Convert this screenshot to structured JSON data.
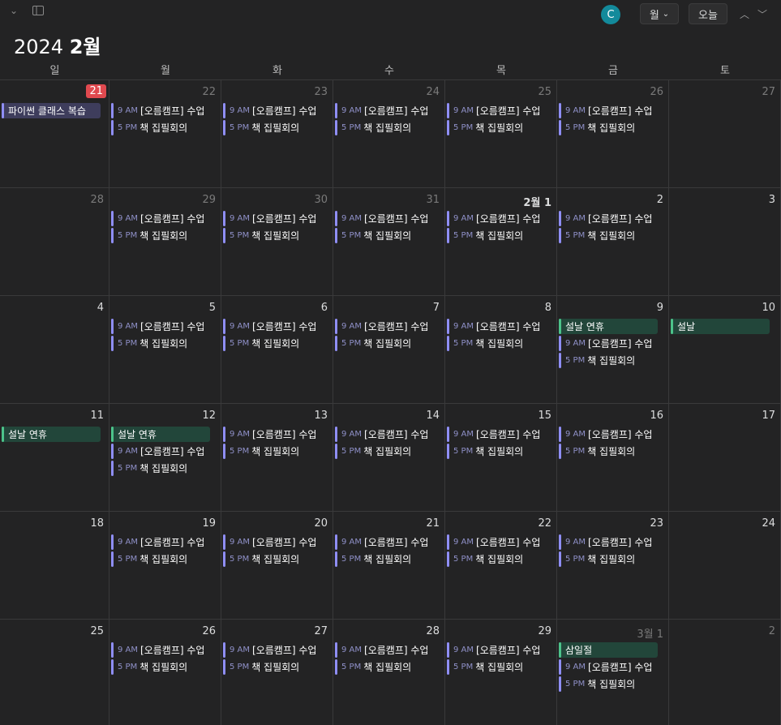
{
  "toolbar": {
    "chevron_glyph": "⌄",
    "sidebar_icon": "sidebar-toggle-icon",
    "avatar_letter": "C",
    "view_label": "월",
    "view_chevron": "⌄",
    "today_label": "오늘",
    "prev_glyph": "︿",
    "next_glyph": "﹀"
  },
  "header": {
    "year": "2024",
    "month": "2월"
  },
  "weekdays": [
    "일",
    "월",
    "화",
    "수",
    "목",
    "금",
    "토"
  ],
  "colors": {
    "background": "#232324",
    "today_badge": "#e0494f",
    "event_bar": "#8f8ef5",
    "holiday": "#4cc38a",
    "avatar": "#138a9b"
  },
  "weeks": [
    [
      {
        "day": "21",
        "dim": false,
        "today": true,
        "events": [
          {
            "type": "allday",
            "style": "study",
            "title": "파이썬 클래스 복습"
          }
        ]
      },
      {
        "day": "22",
        "dim": true,
        "events": [
          {
            "type": "timed",
            "time": "9 AM",
            "title": "[오름캠프] 수업"
          },
          {
            "type": "timed",
            "time": "5 PM",
            "title": "책 집필회의"
          }
        ]
      },
      {
        "day": "23",
        "dim": true,
        "events": [
          {
            "type": "timed",
            "time": "9 AM",
            "title": "[오름캠프] 수업"
          },
          {
            "type": "timed",
            "time": "5 PM",
            "title": "책 집필회의"
          }
        ]
      },
      {
        "day": "24",
        "dim": true,
        "events": [
          {
            "type": "timed",
            "time": "9 AM",
            "title": "[오름캠프] 수업"
          },
          {
            "type": "timed",
            "time": "5 PM",
            "title": "책 집필회의"
          }
        ]
      },
      {
        "day": "25",
        "dim": true,
        "events": [
          {
            "type": "timed",
            "time": "9 AM",
            "title": "[오름캠프] 수업"
          },
          {
            "type": "timed",
            "time": "5 PM",
            "title": "책 집필회의"
          }
        ]
      },
      {
        "day": "26",
        "dim": true,
        "events": [
          {
            "type": "timed",
            "time": "9 AM",
            "title": "[오름캠프] 수업"
          },
          {
            "type": "timed",
            "time": "5 PM",
            "title": "책 집필회의"
          }
        ]
      },
      {
        "day": "27",
        "dim": true,
        "events": []
      }
    ],
    [
      {
        "day": "28",
        "dim": true,
        "events": []
      },
      {
        "day": "29",
        "dim": true,
        "events": [
          {
            "type": "timed",
            "time": "9 AM",
            "title": "[오름캠프] 수업"
          },
          {
            "type": "timed",
            "time": "5 PM",
            "title": "책 집필회의"
          }
        ]
      },
      {
        "day": "30",
        "dim": true,
        "events": [
          {
            "type": "timed",
            "time": "9 AM",
            "title": "[오름캠프] 수업"
          },
          {
            "type": "timed",
            "time": "5 PM",
            "title": "책 집필회의"
          }
        ]
      },
      {
        "day": "31",
        "dim": true,
        "events": [
          {
            "type": "timed",
            "time": "9 AM",
            "title": "[오름캠프] 수업"
          },
          {
            "type": "timed",
            "time": "5 PM",
            "title": "책 집필회의"
          }
        ]
      },
      {
        "day": "2월 1",
        "dim": false,
        "month_start": true,
        "events": [
          {
            "type": "timed",
            "time": "9 AM",
            "title": "[오름캠프] 수업"
          },
          {
            "type": "timed",
            "time": "5 PM",
            "title": "책 집필회의"
          }
        ]
      },
      {
        "day": "2",
        "dim": false,
        "events": [
          {
            "type": "timed",
            "time": "9 AM",
            "title": "[오름캠프] 수업"
          },
          {
            "type": "timed",
            "time": "5 PM",
            "title": "책 집필회의"
          }
        ]
      },
      {
        "day": "3",
        "dim": false,
        "events": []
      }
    ],
    [
      {
        "day": "4",
        "dim": false,
        "events": []
      },
      {
        "day": "5",
        "dim": false,
        "events": [
          {
            "type": "timed",
            "time": "9 AM",
            "title": "[오름캠프] 수업"
          },
          {
            "type": "timed",
            "time": "5 PM",
            "title": "책 집필회의"
          }
        ]
      },
      {
        "day": "6",
        "dim": false,
        "events": [
          {
            "type": "timed",
            "time": "9 AM",
            "title": "[오름캠프] 수업"
          },
          {
            "type": "timed",
            "time": "5 PM",
            "title": "책 집필회의"
          }
        ]
      },
      {
        "day": "7",
        "dim": false,
        "events": [
          {
            "type": "timed",
            "time": "9 AM",
            "title": "[오름캠프] 수업"
          },
          {
            "type": "timed",
            "time": "5 PM",
            "title": "책 집필회의"
          }
        ]
      },
      {
        "day": "8",
        "dim": false,
        "events": [
          {
            "type": "timed",
            "time": "9 AM",
            "title": "[오름캠프] 수업"
          },
          {
            "type": "timed",
            "time": "5 PM",
            "title": "책 집필회의"
          }
        ]
      },
      {
        "day": "9",
        "dim": false,
        "events": [
          {
            "type": "allday",
            "style": "holiday",
            "title": "설날 연휴"
          },
          {
            "type": "timed",
            "time": "9 AM",
            "title": "[오름캠프] 수업"
          },
          {
            "type": "timed",
            "time": "5 PM",
            "title": "책 집필회의"
          }
        ]
      },
      {
        "day": "10",
        "dim": false,
        "events": [
          {
            "type": "allday",
            "style": "holiday",
            "title": "설날"
          }
        ]
      }
    ],
    [
      {
        "day": "11",
        "dim": false,
        "events": [
          {
            "type": "allday",
            "style": "holiday",
            "title": "설날 연휴"
          }
        ]
      },
      {
        "day": "12",
        "dim": false,
        "events": [
          {
            "type": "allday",
            "style": "holiday",
            "title": "설날 연휴"
          },
          {
            "type": "timed",
            "time": "9 AM",
            "title": "[오름캠프] 수업"
          },
          {
            "type": "timed",
            "time": "5 PM",
            "title": "책 집필회의"
          }
        ]
      },
      {
        "day": "13",
        "dim": false,
        "events": [
          {
            "type": "timed",
            "time": "9 AM",
            "title": "[오름캠프] 수업"
          },
          {
            "type": "timed",
            "time": "5 PM",
            "title": "책 집필회의"
          }
        ]
      },
      {
        "day": "14",
        "dim": false,
        "events": [
          {
            "type": "timed",
            "time": "9 AM",
            "title": "[오름캠프] 수업"
          },
          {
            "type": "timed",
            "time": "5 PM",
            "title": "책 집필회의"
          }
        ]
      },
      {
        "day": "15",
        "dim": false,
        "events": [
          {
            "type": "timed",
            "time": "9 AM",
            "title": "[오름캠프] 수업"
          },
          {
            "type": "timed",
            "time": "5 PM",
            "title": "책 집필회의"
          }
        ]
      },
      {
        "day": "16",
        "dim": false,
        "events": [
          {
            "type": "timed",
            "time": "9 AM",
            "title": "[오름캠프] 수업"
          },
          {
            "type": "timed",
            "time": "5 PM",
            "title": "책 집필회의"
          }
        ]
      },
      {
        "day": "17",
        "dim": false,
        "events": []
      }
    ],
    [
      {
        "day": "18",
        "dim": false,
        "events": []
      },
      {
        "day": "19",
        "dim": false,
        "events": [
          {
            "type": "timed",
            "time": "9 AM",
            "title": "[오름캠프] 수업"
          },
          {
            "type": "timed",
            "time": "5 PM",
            "title": "책 집필회의"
          }
        ]
      },
      {
        "day": "20",
        "dim": false,
        "events": [
          {
            "type": "timed",
            "time": "9 AM",
            "title": "[오름캠프] 수업"
          },
          {
            "type": "timed",
            "time": "5 PM",
            "title": "책 집필회의"
          }
        ]
      },
      {
        "day": "21",
        "dim": false,
        "events": [
          {
            "type": "timed",
            "time": "9 AM",
            "title": "[오름캠프] 수업"
          },
          {
            "type": "timed",
            "time": "5 PM",
            "title": "책 집필회의"
          }
        ]
      },
      {
        "day": "22",
        "dim": false,
        "events": [
          {
            "type": "timed",
            "time": "9 AM",
            "title": "[오름캠프] 수업"
          },
          {
            "type": "timed",
            "time": "5 PM",
            "title": "책 집필회의"
          }
        ]
      },
      {
        "day": "23",
        "dim": false,
        "events": [
          {
            "type": "timed",
            "time": "9 AM",
            "title": "[오름캠프] 수업"
          },
          {
            "type": "timed",
            "time": "5 PM",
            "title": "책 집필회의"
          }
        ]
      },
      {
        "day": "24",
        "dim": false,
        "events": []
      }
    ],
    [
      {
        "day": "25",
        "dim": false,
        "events": []
      },
      {
        "day": "26",
        "dim": false,
        "events": [
          {
            "type": "timed",
            "time": "9 AM",
            "title": "[오름캠프] 수업"
          },
          {
            "type": "timed",
            "time": "5 PM",
            "title": "책 집필회의"
          }
        ]
      },
      {
        "day": "27",
        "dim": false,
        "events": [
          {
            "type": "timed",
            "time": "9 AM",
            "title": "[오름캠프] 수업"
          },
          {
            "type": "timed",
            "time": "5 PM",
            "title": "책 집필회의"
          }
        ]
      },
      {
        "day": "28",
        "dim": false,
        "events": [
          {
            "type": "timed",
            "time": "9 AM",
            "title": "[오름캠프] 수업"
          },
          {
            "type": "timed",
            "time": "5 PM",
            "title": "책 집필회의"
          }
        ]
      },
      {
        "day": "29",
        "dim": false,
        "events": [
          {
            "type": "timed",
            "time": "9 AM",
            "title": "[오름캠프] 수업"
          },
          {
            "type": "timed",
            "time": "5 PM",
            "title": "책 집필회의"
          }
        ]
      },
      {
        "day": "3월 1",
        "dim": true,
        "events": [
          {
            "type": "allday",
            "style": "holiday",
            "title": "삼일절"
          },
          {
            "type": "timed",
            "time": "9 AM",
            "title": "[오름캠프] 수업"
          },
          {
            "type": "timed",
            "time": "5 PM",
            "title": "책 집필회의"
          }
        ]
      },
      {
        "day": "2",
        "dim": true,
        "events": []
      }
    ]
  ]
}
